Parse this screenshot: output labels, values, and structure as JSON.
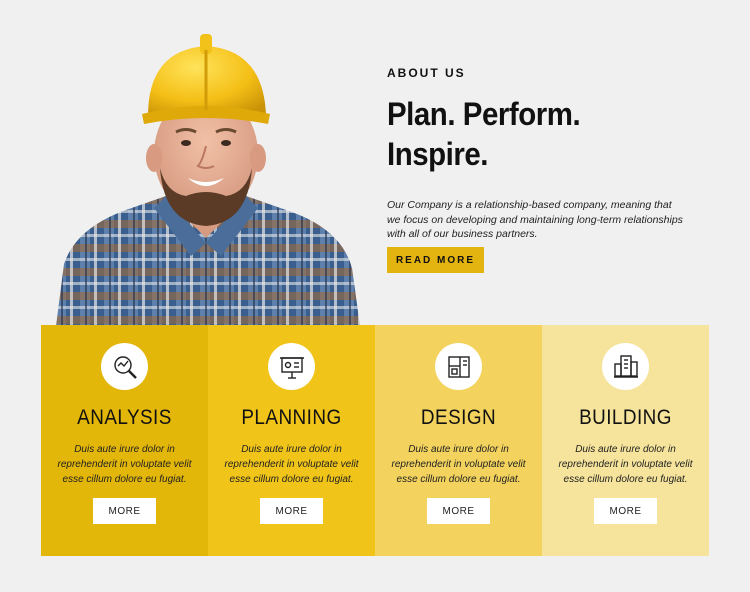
{
  "about": {
    "eyebrow": "ABOUT US",
    "headline_line1": "Plan. Perform.",
    "headline_line2": "Inspire.",
    "description": "Our Company is a relationship-based company, meaning that we focus on developing and maintaining long-term relationships with all of our business partners.",
    "button_label": "READ MORE"
  },
  "colors": {
    "accent": "#e3b30f",
    "card1": "#e3b60a",
    "card2": "#f0c419",
    "card3": "#f3d35e",
    "card4": "#f6e49c"
  },
  "cards": [
    {
      "title": "ANALYSIS",
      "text": "Duis aute irure dolor in reprehenderit in voluptate velit esse cillum dolore eu fugiat.",
      "button": "MORE",
      "icon": "magnifier-chart-icon"
    },
    {
      "title": "PLANNING",
      "text": "Duis aute irure dolor in reprehenderit in voluptate velit esse cillum dolore eu fugiat.",
      "button": "MORE",
      "icon": "presentation-board-icon"
    },
    {
      "title": "DESIGN",
      "text": "Duis aute irure dolor in reprehenderit in voluptate velit esse cillum dolore eu fugiat.",
      "button": "MORE",
      "icon": "blueprint-icon"
    },
    {
      "title": "BUILDING",
      "text": "Duis aute irure dolor in reprehenderit in voluptate velit esse cillum dolore eu fugiat.",
      "button": "MORE",
      "icon": "buildings-icon"
    }
  ]
}
